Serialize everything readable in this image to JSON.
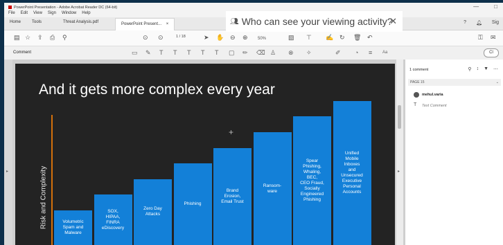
{
  "app": {
    "window_title": "PowerPoint Presentation - Adobe Acrobat Reader DC (64-bit)",
    "window_controls": [
      "—",
      "□"
    ]
  },
  "menu": [
    "File",
    "Edit",
    "View",
    "Sign",
    "Window",
    "Help"
  ],
  "tabs": {
    "home": "Home",
    "tools": "Tools",
    "doc1": "Threat Analysis.pdf",
    "doc2": "PowerPoint Present...",
    "doc2_close": "×",
    "sign_in": "Sig"
  },
  "toolbar": {
    "page_current": "1",
    "page_total": "/ 18",
    "zoom": "50%"
  },
  "comment_bar": {
    "label": "Comment",
    "close": "Cl"
  },
  "popup": {
    "text": "Who can see your viewing activity?",
    "close": "✕"
  },
  "slide": {
    "title": "And it gets more complex every year",
    "y_axis_label": "Risk and Complexity",
    "plus": "+"
  },
  "chart_data": {
    "type": "bar",
    "categories": [
      "Volumetric Spam and Malware",
      "SOX, HIPAA, FINRA eDiscovery",
      "Zero Day Attacks",
      "Phishing",
      "Brand Erosion, Email Trust",
      "Ransom-ware",
      "Spear Phishing, Whaling, BEC, CEO Fraud, Socially Engineered Phishing",
      "Unified Mobile Inboxes and Unsecured Executive Personal Accounts"
    ],
    "bar_lines": [
      [
        "Volumetric",
        "Spam and",
        "Malware"
      ],
      [
        "SOX,",
        "HIPAA,",
        "FINRA",
        "eDiscovery"
      ],
      [
        "Zero Day",
        "Attacks"
      ],
      [
        "Phishing"
      ],
      [
        "Brand",
        "Erosion,",
        "Email Trust"
      ],
      [
        "Ransom-",
        "ware"
      ],
      [
        "Spear",
        "Phishing,",
        "Whaling,",
        "BEC,",
        "CEO Fraud,",
        "Socially",
        "Engineered",
        "Phishing"
      ],
      [
        "Unified",
        "Mobile",
        "Inboxes",
        "and",
        "Unsecured",
        "Executive",
        "Personal",
        "Accounts"
      ]
    ],
    "values": [
      1,
      2,
      3,
      4,
      5,
      6,
      7,
      8
    ],
    "ylabel": "Risk and Complexity",
    "title": "And it gets more complex every year",
    "color": "#1380d8"
  },
  "right_panel": {
    "header": "1 comment",
    "page_label": "PAGE 15",
    "author": "mehul.varia",
    "comment_text": "Text Comment"
  },
  "colors": {
    "accent": "#1380d8",
    "axis": "#d4700a",
    "slide_bg": "#232323"
  }
}
